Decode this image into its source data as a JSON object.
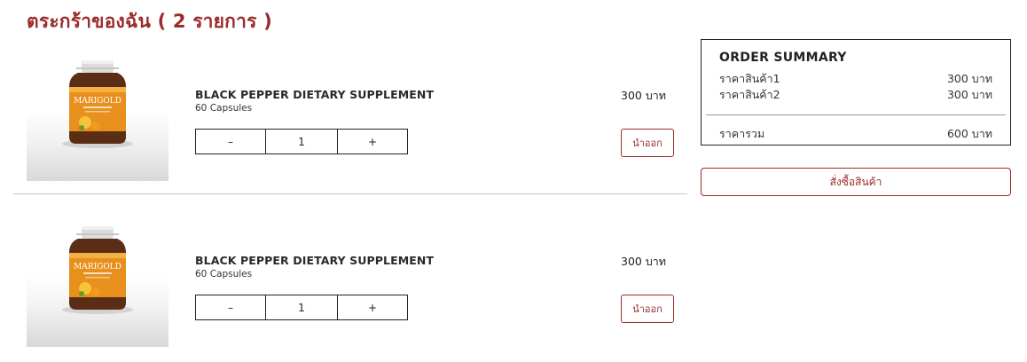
{
  "page": {
    "title": "ตระกร้าของฉัน ( 2 รายการ )"
  },
  "cart": {
    "items": [
      {
        "image_icon": "supplement-bottle-icon",
        "brand_label": "MARIGOLD",
        "name": "BLACK PEPPER DIETARY SUPPLEMENT",
        "variant": "60 Capsules",
        "quantity": "1",
        "decrement_label": "–",
        "increment_label": "+",
        "price": "300 บาท",
        "remove_label": "นำออก"
      },
      {
        "image_icon": "supplement-bottle-icon",
        "brand_label": "MARIGOLD",
        "name": "BLACK PEPPER DIETARY SUPPLEMENT",
        "variant": "60 Capsules",
        "quantity": "1",
        "decrement_label": "–",
        "increment_label": "+",
        "price": "300 บาท",
        "remove_label": "นำออก"
      }
    ]
  },
  "summary": {
    "title": "ORDER SUMMARY",
    "rows": [
      {
        "label": "ราคาสินค้า1",
        "value": "300 บาท"
      },
      {
        "label": "ราคาสินค้า2",
        "value": "300 บาท"
      }
    ],
    "total_label": "ราคารวม",
    "total_value": "600 บาท"
  },
  "checkout": {
    "label": "สั่งซื้อสินค้า"
  },
  "colors": {
    "accent": "#9b2a2a",
    "bottle": "#5a2e14",
    "label_orange": "#e8901e",
    "cap": "#d9d9d9"
  }
}
